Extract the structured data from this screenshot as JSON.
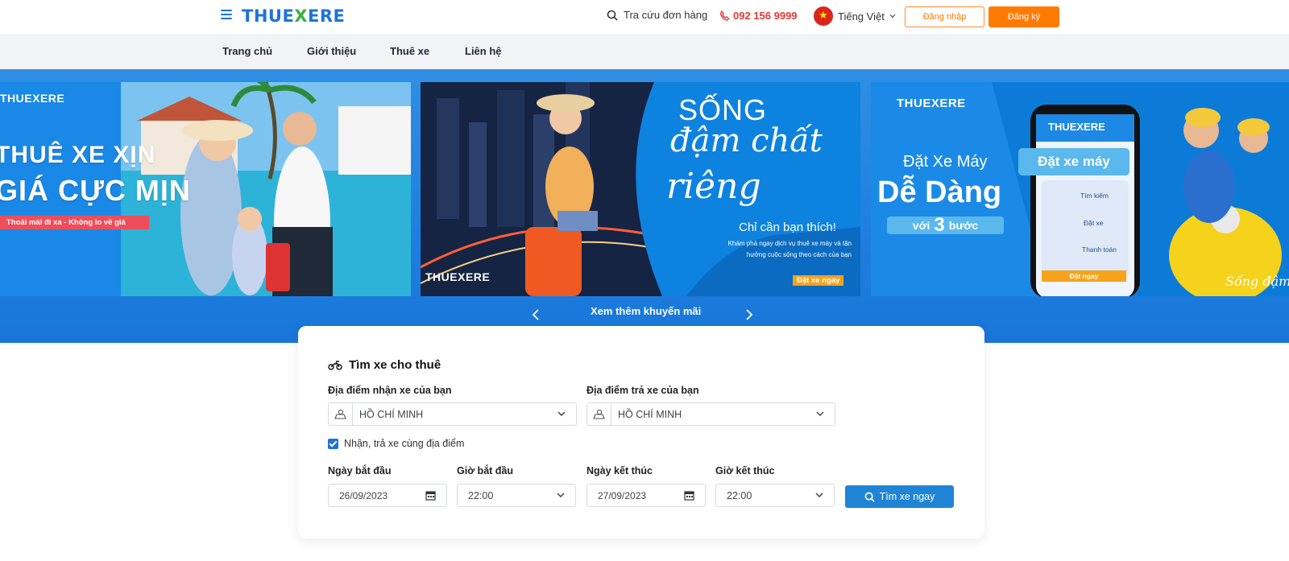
{
  "header": {
    "logo_main": "THUE",
    "logo_x": "X",
    "logo_end": "ERE",
    "lookup_label": "Tra cứu đơn hàng",
    "phone": "092 156 9999",
    "language": "Tiếng Việt",
    "login_label": "Đăng nhập",
    "register_label": "Đăng ký"
  },
  "nav": {
    "items": [
      "Trang chủ",
      "Giới thiệu",
      "Thuê xe",
      "Liên hệ"
    ]
  },
  "banners": {
    "b1": {
      "logo": "THUEXERE",
      "line1": "THUÊ XE XỊN",
      "line2": "GIÁ CỰC MỊN",
      "tag": "Thoải mái đi xa - Không lo về giá"
    },
    "b2": {
      "line1": "SỐNG",
      "line2": "đậm chất",
      "line3": "riêng",
      "sub": "Chỉ cần bạn thích!",
      "desc": "Khám phá ngay dịch vụ thuê xe máy và tận hưởng cuộc sống theo cách của bạn",
      "cta": "Đặt xe ngay",
      "logo": "THUEXERE"
    },
    "b3": {
      "logo": "THUEXERE",
      "line1": "Đặt Xe Máy",
      "line2": "Dễ Dàng",
      "steps_prefix": "với",
      "steps_num": "3",
      "steps_suffix": "bước",
      "phone_logo": "THUEXERE",
      "phone_cta_title": "Đặt xe máy",
      "step1": "Tìm kiếm",
      "step2": "Đặt xe",
      "step3": "Thanh toán",
      "phone_cta": "Đặt ngay",
      "tagline": "Sống đậm chất"
    }
  },
  "promo": {
    "label": "Xem thêm khuyến mãi"
  },
  "search": {
    "title": "Tìm xe cho thuê",
    "pickup_label": "Địa điểm nhận xe của bạn",
    "pickup_value": "HỒ CHÍ MINH",
    "dropoff_label": "Địa điểm trả xe của bạn",
    "dropoff_value": "HỒ CHÍ MINH",
    "same_location": "Nhận, trả xe cùng địa điểm",
    "start_date_label": "Ngày bắt đầu",
    "start_date": "26/09/2023",
    "start_time_label": "Giờ bắt đầu",
    "start_time": "22:00",
    "end_date_label": "Ngày kết thúc",
    "end_date": "27/09/2023",
    "end_time_label": "Giờ kết thúc",
    "end_time": "22:00",
    "button": "Tìm xe ngay"
  },
  "colors": {
    "brand_blue": "#1e73d8",
    "brand_green": "#3fae49",
    "accent_orange": "#ff7a00",
    "phone_red": "#e53935"
  }
}
